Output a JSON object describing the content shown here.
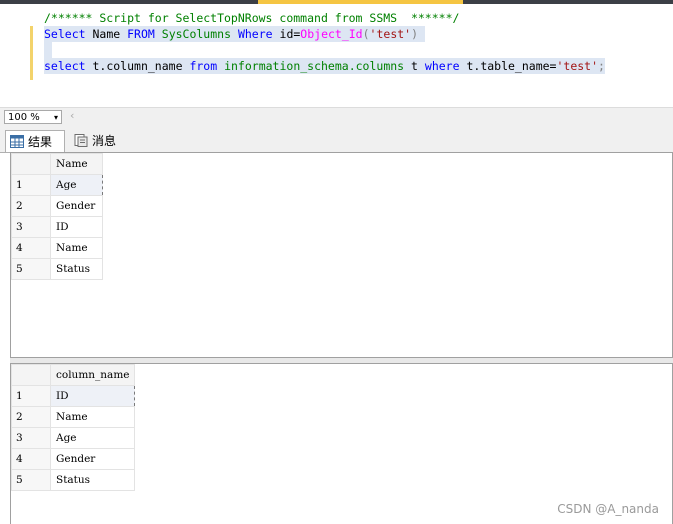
{
  "editor": {
    "comment_line": "/****** Script for SelectTopNRows command from SSMS  ******/",
    "line2": {
      "kw_select": "Select",
      "col": "Name",
      "kw_from": "FROM",
      "table": "SysColumns",
      "kw_where": "Where",
      "cond_left": "id=",
      "fn": "Object_Id",
      "open": "(",
      "str": "'test'",
      "close": ")"
    },
    "line4": {
      "kw_select": "select",
      "col_expr": "t.column_name",
      "kw_from": "from",
      "table": "information_schema.columns",
      "alias": "t",
      "kw_where": "where",
      "cond": "t.table_name=",
      "str": "'test'",
      "semi": ";"
    }
  },
  "zoom": {
    "value": "100 %",
    "arrow": "▾",
    "scroll_left": "‹"
  },
  "tabs": [
    {
      "label": "结果",
      "icon": "grid-icon",
      "active": true
    },
    {
      "label": "消息",
      "icon": "messages-icon",
      "active": false
    }
  ],
  "grid1": {
    "header": "Name",
    "rows": [
      {
        "n": "1",
        "v": "Age"
      },
      {
        "n": "2",
        "v": "Gender"
      },
      {
        "n": "3",
        "v": "ID"
      },
      {
        "n": "4",
        "v": "Name"
      },
      {
        "n": "5",
        "v": "Status"
      }
    ]
  },
  "grid2": {
    "header": "column_name",
    "rows": [
      {
        "n": "1",
        "v": "ID"
      },
      {
        "n": "2",
        "v": "Name"
      },
      {
        "n": "3",
        "v": "Age"
      },
      {
        "n": "4",
        "v": "Gender"
      },
      {
        "n": "5",
        "v": "Status"
      }
    ]
  },
  "watermark": "CSDN @A_nanda"
}
